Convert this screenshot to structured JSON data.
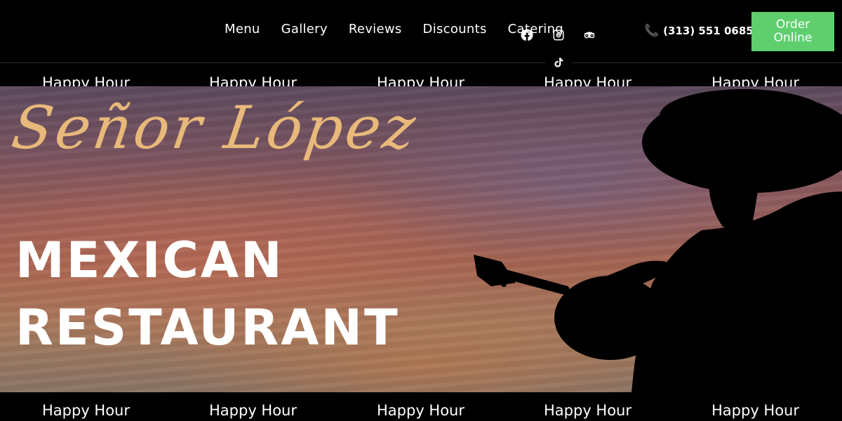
{
  "nav": {
    "items": [
      {
        "label": "Menu"
      },
      {
        "label": "Gallery"
      },
      {
        "label": "Reviews"
      },
      {
        "label": "Discounts"
      },
      {
        "label": "Catering"
      }
    ]
  },
  "social": {
    "icons": [
      "facebook-icon",
      "instagram-icon",
      "tripadvisor-icon",
      "tiktok-icon"
    ]
  },
  "contact": {
    "phone_icon": "phone-icon",
    "phone_number": "(313) 551 0685"
  },
  "order_button": {
    "line1": "Order",
    "line2": "Online",
    "color": "#5fcf6e"
  },
  "ticker": {
    "items": [
      "Happy Hour",
      "Happy Hour",
      "Happy Hour",
      "Happy Hour",
      "Happy Hour"
    ]
  },
  "hero": {
    "script_title": "Señor López",
    "headline_line1": "MEXICAN",
    "headline_line2": "RESTAURANT",
    "script_color": "#e8b97a"
  }
}
